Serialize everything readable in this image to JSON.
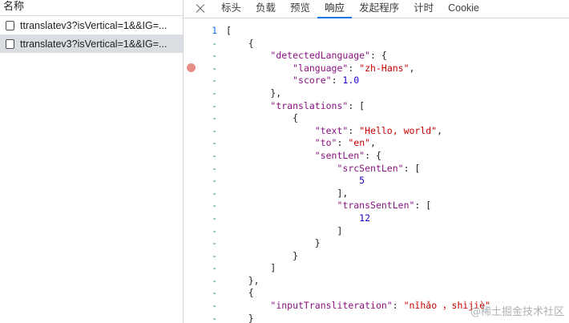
{
  "request_list": {
    "header_label": "名称",
    "items": [
      {
        "name": "ttranslatev3?isVertical=1&&IG=...",
        "selected": false
      },
      {
        "name": "ttranslatev3?isVertical=1&&IG=...",
        "selected": true
      }
    ]
  },
  "tabs": [
    {
      "label": "标头",
      "active": false
    },
    {
      "label": "负载",
      "active": false
    },
    {
      "label": "预览",
      "active": false
    },
    {
      "label": "响应",
      "active": true
    },
    {
      "label": "发起程序",
      "active": false
    },
    {
      "label": "计时",
      "active": false
    },
    {
      "label": "Cookie",
      "active": false
    }
  ],
  "response": {
    "lines": [
      {
        "gutter": "1",
        "tokens": [
          [
            "pun",
            "["
          ]
        ]
      },
      {
        "gutter": "-",
        "tokens": [
          [
            "pun",
            "    {"
          ]
        ]
      },
      {
        "gutter": "-",
        "tokens": [
          [
            "pun",
            "        "
          ],
          [
            "key",
            "\"detectedLanguage\""
          ],
          [
            "pun",
            ": {"
          ]
        ]
      },
      {
        "gutter": "-",
        "tokens": [
          [
            "pun",
            "            "
          ],
          [
            "key",
            "\"language\""
          ],
          [
            "pun",
            ": "
          ],
          [
            "str",
            "\"zh-Hans\""
          ],
          [
            "pun",
            ","
          ]
        ]
      },
      {
        "gutter": "-",
        "tokens": [
          [
            "pun",
            "            "
          ],
          [
            "key",
            "\"score\""
          ],
          [
            "pun",
            ": "
          ],
          [
            "num",
            "1.0"
          ]
        ]
      },
      {
        "gutter": "-",
        "tokens": [
          [
            "pun",
            "        },"
          ]
        ]
      },
      {
        "gutter": "-",
        "tokens": [
          [
            "pun",
            "        "
          ],
          [
            "key",
            "\"translations\""
          ],
          [
            "pun",
            ": ["
          ]
        ]
      },
      {
        "gutter": "-",
        "tokens": [
          [
            "pun",
            "            {"
          ]
        ]
      },
      {
        "gutter": "-",
        "tokens": [
          [
            "pun",
            "                "
          ],
          [
            "key",
            "\"text\""
          ],
          [
            "pun",
            ": "
          ],
          [
            "str",
            "\"Hello, world\""
          ],
          [
            "pun",
            ","
          ]
        ]
      },
      {
        "gutter": "-",
        "tokens": [
          [
            "pun",
            "                "
          ],
          [
            "key",
            "\"to\""
          ],
          [
            "pun",
            ": "
          ],
          [
            "str",
            "\"en\""
          ],
          [
            "pun",
            ","
          ]
        ]
      },
      {
        "gutter": "-",
        "tokens": [
          [
            "pun",
            "                "
          ],
          [
            "key",
            "\"sentLen\""
          ],
          [
            "pun",
            ": {"
          ]
        ]
      },
      {
        "gutter": "-",
        "tokens": [
          [
            "pun",
            "                    "
          ],
          [
            "key",
            "\"srcSentLen\""
          ],
          [
            "pun",
            ": ["
          ]
        ]
      },
      {
        "gutter": "-",
        "tokens": [
          [
            "pun",
            "                        "
          ],
          [
            "num",
            "5"
          ]
        ]
      },
      {
        "gutter": "-",
        "tokens": [
          [
            "pun",
            "                    ],"
          ]
        ]
      },
      {
        "gutter": "-",
        "tokens": [
          [
            "pun",
            "                    "
          ],
          [
            "key",
            "\"transSentLen\""
          ],
          [
            "pun",
            ": ["
          ]
        ]
      },
      {
        "gutter": "-",
        "tokens": [
          [
            "pun",
            "                        "
          ],
          [
            "num",
            "12"
          ]
        ]
      },
      {
        "gutter": "-",
        "tokens": [
          [
            "pun",
            "                    ]"
          ]
        ]
      },
      {
        "gutter": "-",
        "tokens": [
          [
            "pun",
            "                }"
          ]
        ]
      },
      {
        "gutter": "-",
        "tokens": [
          [
            "pun",
            "            }"
          ]
        ]
      },
      {
        "gutter": "-",
        "tokens": [
          [
            "pun",
            "        ]"
          ]
        ]
      },
      {
        "gutter": "-",
        "tokens": [
          [
            "pun",
            "    },"
          ]
        ]
      },
      {
        "gutter": "-",
        "tokens": [
          [
            "pun",
            "    {"
          ]
        ]
      },
      {
        "gutter": "-",
        "tokens": [
          [
            "pun",
            "        "
          ],
          [
            "key",
            "\"inputTransliteration\""
          ],
          [
            "pun",
            ": "
          ],
          [
            "str",
            "\"nǐhǎo ，shìjiè\""
          ]
        ]
      },
      {
        "gutter": "-",
        "tokens": [
          [
            "pun",
            "    }"
          ]
        ]
      }
    ]
  },
  "colors": {
    "key": "#881280",
    "string": "#c80000",
    "number": "#1c00cf",
    "gutter_dash": "#1e8e3e",
    "active_tab_underline": "#1a73e8",
    "breakpoint": "#e88c86"
  },
  "watermark": "@稀土掘金技术社区"
}
